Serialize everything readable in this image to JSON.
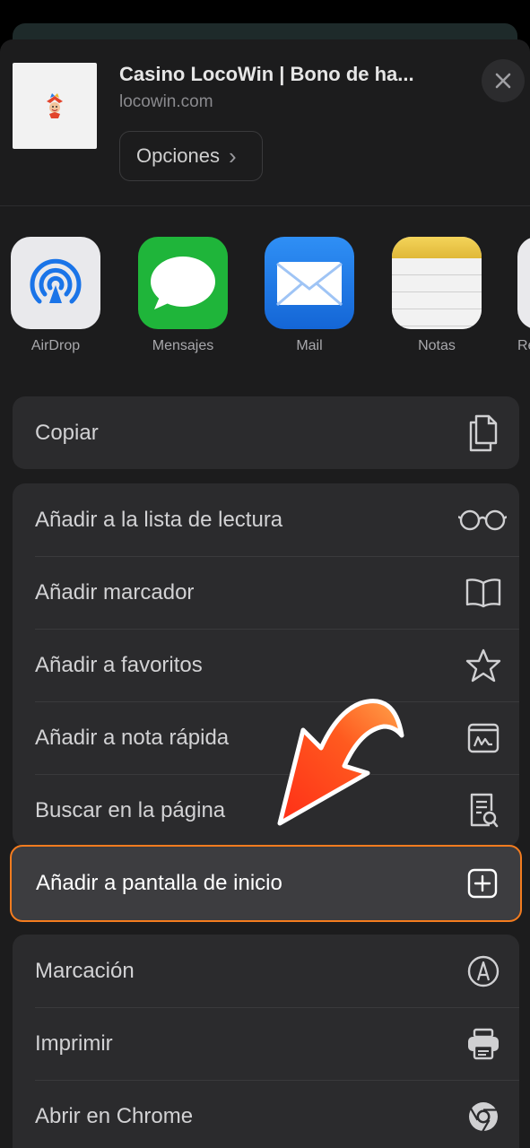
{
  "header": {
    "title": "Casino LocoWin | Bono de ha...",
    "url": "locowin.com",
    "options_label": "Opciones",
    "options_chevron": "›"
  },
  "apps": [
    {
      "label": "AirDrop",
      "icon": "airdrop-icon"
    },
    {
      "label": "Mensajes",
      "icon": "messages-icon"
    },
    {
      "label": "Mail",
      "icon": "mail-icon"
    },
    {
      "label": "Notas",
      "icon": "notes-icon"
    },
    {
      "label": "Re",
      "icon": "reminders-icon"
    }
  ],
  "actions": {
    "copy": "Copiar",
    "reading_list": "Añadir a la lista de lectura",
    "bookmark": "Añadir marcador",
    "favorites": "Añadir a favoritos",
    "quick_note": "Añadir a nota rápida",
    "find_on_page": "Buscar en la página",
    "add_home_screen": "Añadir a pantalla de inicio",
    "markup": "Marcación",
    "print": "Imprimir",
    "open_chrome": "Abrir en Chrome"
  },
  "colors": {
    "highlight_border": "#f47c1f",
    "arrow": "#ff5a1f",
    "sheet_bg": "#1c1c1d",
    "group_bg": "#2b2b2d"
  }
}
